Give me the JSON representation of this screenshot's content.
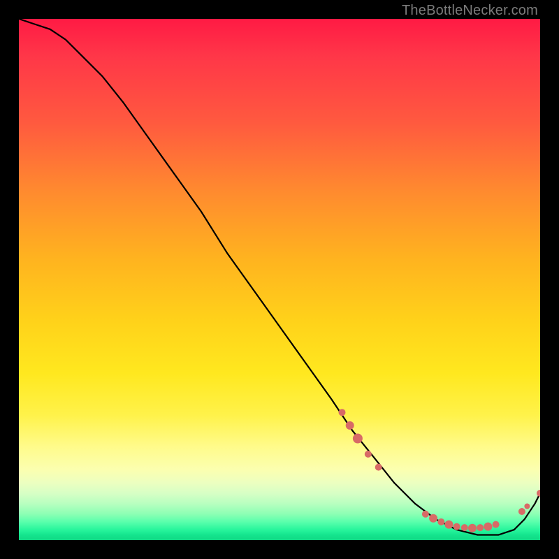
{
  "attribution": "TheBottleNecker.com",
  "chart_data": {
    "type": "line",
    "title": "",
    "xlabel": "",
    "ylabel": "",
    "xlim": [
      0,
      100
    ],
    "ylim": [
      0,
      100
    ],
    "series": [
      {
        "name": "curve",
        "x": [
          0,
          3,
          6,
          9,
          12,
          16,
          20,
          25,
          30,
          35,
          40,
          45,
          50,
          55,
          60,
          64,
          68,
          72,
          76,
          80,
          84,
          88,
          92,
          95,
          97,
          99,
          100
        ],
        "values": [
          100,
          99,
          98,
          96,
          93,
          89,
          84,
          77,
          70,
          63,
          55,
          48,
          41,
          34,
          27,
          21,
          16,
          11,
          7,
          4,
          2,
          1,
          1,
          2,
          4,
          7,
          9
        ],
        "color": "#000000",
        "stroke_width": 2.2
      }
    ],
    "markers": [
      {
        "x": 62.0,
        "y": 24.5,
        "r": 5
      },
      {
        "x": 63.5,
        "y": 22.0,
        "r": 6
      },
      {
        "x": 65.0,
        "y": 19.5,
        "r": 7
      },
      {
        "x": 67.0,
        "y": 16.5,
        "r": 5
      },
      {
        "x": 69.0,
        "y": 14.0,
        "r": 5
      },
      {
        "x": 78.0,
        "y": 5.0,
        "r": 5
      },
      {
        "x": 79.5,
        "y": 4.2,
        "r": 6
      },
      {
        "x": 81.0,
        "y": 3.5,
        "r": 5
      },
      {
        "x": 82.5,
        "y": 3.0,
        "r": 6
      },
      {
        "x": 84.0,
        "y": 2.6,
        "r": 5
      },
      {
        "x": 85.5,
        "y": 2.4,
        "r": 5
      },
      {
        "x": 87.0,
        "y": 2.3,
        "r": 6
      },
      {
        "x": 88.5,
        "y": 2.4,
        "r": 5
      },
      {
        "x": 90.0,
        "y": 2.6,
        "r": 6
      },
      {
        "x": 91.5,
        "y": 3.0,
        "r": 5
      },
      {
        "x": 96.5,
        "y": 5.5,
        "r": 5
      },
      {
        "x": 97.5,
        "y": 6.5,
        "r": 4
      },
      {
        "x": 100.0,
        "y": 9.0,
        "r": 5
      }
    ],
    "marker_color": "#d86a66"
  }
}
